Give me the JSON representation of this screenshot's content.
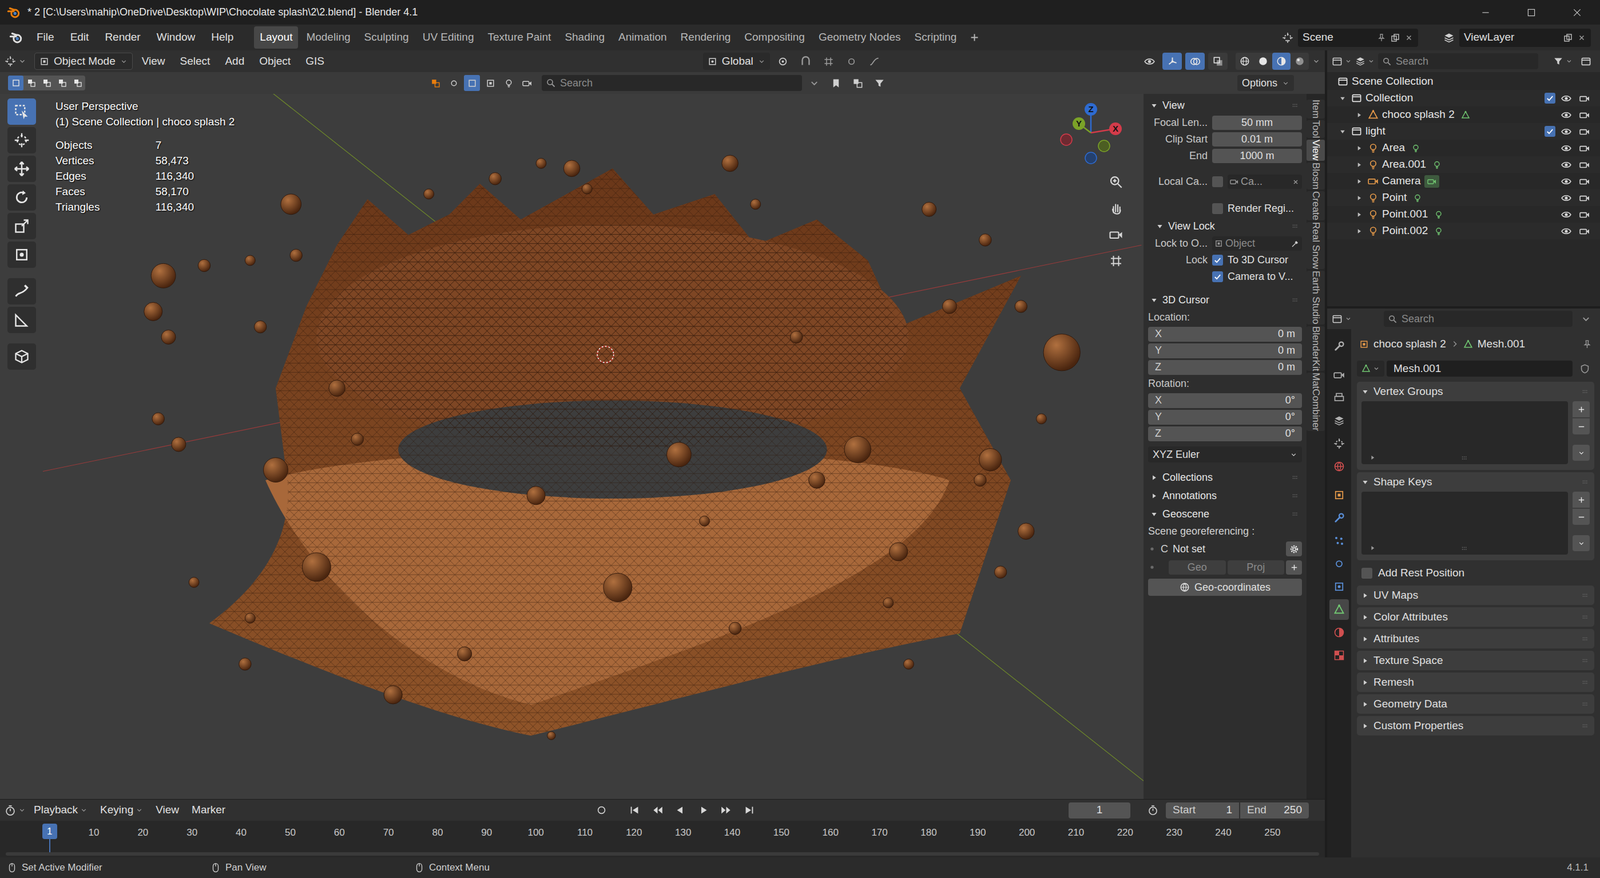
{
  "window": {
    "title": "* 2 [C:\\Users\\mahip\\OneDrive\\Desktop\\WIP\\Chocolate splash\\2\\2.blend] - Blender 4.1"
  },
  "menu": [
    "File",
    "Edit",
    "Render",
    "Window",
    "Help"
  ],
  "workspaces": [
    {
      "label": "Layout",
      "selected": true
    },
    {
      "label": "Modeling",
      "selected": false
    },
    {
      "label": "Sculpting",
      "selected": false
    },
    {
      "label": "UV Editing",
      "selected": false
    },
    {
      "label": "Texture Paint",
      "selected": false
    },
    {
      "label": "Shading",
      "selected": false
    },
    {
      "label": "Animation",
      "selected": false
    },
    {
      "label": "Rendering",
      "selected": false
    },
    {
      "label": "Compositing",
      "selected": false
    },
    {
      "label": "Geometry Nodes",
      "selected": false
    },
    {
      "label": "Scripting",
      "selected": false
    }
  ],
  "scene": "Scene",
  "view_layer": "ViewLayer",
  "viewport_header": {
    "mode": "Object Mode",
    "menus": [
      "View",
      "Select",
      "Add",
      "Object",
      "GIS"
    ],
    "orientation": "Global",
    "toggles": [
      {
        "kind": "gizmo",
        "on": true
      },
      {
        "kind": "overlay",
        "on": true
      },
      {
        "kind": "xray",
        "on": false
      }
    ],
    "shading": [
      {
        "kind": "wire",
        "selected": false
      },
      {
        "kind": "solid",
        "selected": false
      },
      {
        "kind": "mat",
        "selected": true
      },
      {
        "kind": "rendered",
        "selected": false
      }
    ]
  },
  "tool_header": {
    "select_modes": [
      {
        "kind": "set",
        "selected": true
      },
      {
        "kind": "extend",
        "selected": false
      },
      {
        "kind": "subtract",
        "selected": false
      },
      {
        "kind": "invert",
        "selected": false
      },
      {
        "kind": "intersect",
        "selected": false
      }
    ],
    "search_placeholder": "Search",
    "options": "Options"
  },
  "toolbar": [
    {
      "kind": "select",
      "selected": true
    },
    {
      "kind": "cursor3d",
      "selected": false
    },
    {
      "kind": "move",
      "selected": false
    },
    {
      "kind": "rotate",
      "selected": false
    },
    {
      "kind": "scale",
      "selected": false
    },
    {
      "kind": "transform",
      "selected": false
    },
    {
      "kind": "annotate",
      "selected": false
    },
    {
      "kind": "measure",
      "selected": false
    },
    {
      "kind": "addcube",
      "selected": false
    }
  ],
  "viewport": {
    "perspective": "User Perspective",
    "context": "(1) Scene Collection | choco splash 2",
    "stats": [
      {
        "label": "Objects",
        "value": "7"
      },
      {
        "label": "Vertices",
        "value": "58,473"
      },
      {
        "label": "Edges",
        "value": "116,340"
      },
      {
        "label": "Faces",
        "value": "58,170"
      },
      {
        "label": "Triangles",
        "value": "116,340"
      }
    ],
    "gizmo": {
      "x": "X",
      "y": "Y",
      "z": "Z"
    }
  },
  "n_panel": {
    "view": {
      "title": "View",
      "expanded": true,
      "fields": [
        {
          "label": "Focal Len...",
          "value": "50 mm"
        },
        {
          "label": "Clip Start",
          "value": "0.01 m"
        },
        {
          "label": "End",
          "value": "1000 m"
        }
      ],
      "local_camera": {
        "label": "Local Ca...",
        "checked": false,
        "value": "Ca..."
      },
      "render_region": {
        "label": "Render Regi...",
        "checked": false
      }
    },
    "view_lock": {
      "title": "View Lock",
      "expanded": true,
      "lock_to": {
        "label": "Lock to O...",
        "placeholder": "Object"
      },
      "lock_label": "Lock",
      "checks": [
        {
          "label": "To 3D Cursor",
          "checked": true
        },
        {
          "label": "Camera to V...",
          "checked": true
        }
      ]
    },
    "cursor": {
      "title": "3D Cursor",
      "expanded": true,
      "location_label": "Location:",
      "location": [
        {
          "axis": "X",
          "value": "0 m"
        },
        {
          "axis": "Y",
          "value": "0 m"
        },
        {
          "axis": "Z",
          "value": "0 m"
        }
      ],
      "rotation_label": "Rotation:",
      "rotation": [
        {
          "axis": "X",
          "value": "0°"
        },
        {
          "axis": "Y",
          "value": "0°"
        },
        {
          "axis": "Z",
          "value": "0°"
        }
      ],
      "rotation_mode": "XYZ Euler"
    },
    "collapsed": [
      {
        "title": "Collections",
        "expanded": false
      },
      {
        "title": "Annotations",
        "expanded": false
      }
    ],
    "geoscene": {
      "title": "Geoscene",
      "expanded": true,
      "label": "Scene georeferencing :",
      "crs_letter": "C",
      "crs_status": "Not set",
      "buttons": [
        {
          "label": "Geo",
          "disabled": true
        },
        {
          "label": "Proj",
          "disabled": true
        }
      ],
      "action": "Geo-coordinates"
    }
  },
  "side_tabs": [
    {
      "label": "Item",
      "selected": false
    },
    {
      "label": "Tool",
      "selected": false
    },
    {
      "label": "View",
      "selected": true
    },
    {
      "label": "Blosm",
      "selected": false
    },
    {
      "label": "Create",
      "selected": false
    },
    {
      "label": "Real Snow",
      "selected": false
    },
    {
      "label": "Earth Studio",
      "selected": false
    },
    {
      "label": "BlenderKit",
      "selected": false
    },
    {
      "label": "MatCombiner",
      "selected": false
    }
  ],
  "outliner": {
    "search_placeholder": "Search",
    "rows": [
      {
        "label": "Scene Collection",
        "depth": 0,
        "kind": "scene"
      },
      {
        "label": "Collection",
        "depth": 1,
        "kind": "collection",
        "expanded": true,
        "checked": true,
        "visible": true
      },
      {
        "label": "choco splash 2",
        "depth": 2,
        "kind": "mesh",
        "expanded": false,
        "visible": true
      },
      {
        "label": "light",
        "depth": 1,
        "kind": "collection",
        "expanded": true,
        "checked": true,
        "visible": true
      },
      {
        "label": "Area",
        "depth": 2,
        "kind": "light",
        "expanded": false,
        "visible": true
      },
      {
        "label": "Area.001",
        "depth": 2,
        "kind": "light",
        "expanded": false,
        "visible": true
      },
      {
        "label": "Camera",
        "depth": 2,
        "kind": "camera",
        "expanded": false,
        "visible": true
      },
      {
        "label": "Point",
        "depth": 2,
        "kind": "light",
        "expanded": false,
        "visible": true
      },
      {
        "label": "Point.001",
        "depth": 2,
        "kind": "light",
        "expanded": false,
        "visible": true
      },
      {
        "label": "Point.002",
        "depth": 2,
        "kind": "light",
        "expanded": false,
        "visible": true
      }
    ]
  },
  "properties": {
    "search_placeholder": "Search",
    "breadcrumb": [
      "choco splash 2",
      "Mesh.001"
    ],
    "datablock": "Mesh.001",
    "tabs": [
      {
        "kind": "tool",
        "selected": false
      },
      {
        "kind": "render",
        "selected": false
      },
      {
        "kind": "output",
        "selected": false
      },
      {
        "kind": "view_layer",
        "selected": false
      },
      {
        "kind": "scene",
        "selected": false
      },
      {
        "kind": "world",
        "selected": false
      },
      {
        "kind": "object",
        "selected": false
      },
      {
        "kind": "modifiers",
        "selected": false
      },
      {
        "kind": "particles",
        "selected": false
      },
      {
        "kind": "physics",
        "selected": false
      },
      {
        "kind": "constraints",
        "selected": false
      },
      {
        "kind": "data",
        "selected": true
      },
      {
        "kind": "material",
        "selected": false
      },
      {
        "kind": "texture",
        "selected": false
      }
    ],
    "panels": [
      {
        "title": "Vertex Groups",
        "kind": "list",
        "expanded": true
      },
      {
        "title": "Shape Keys",
        "kind": "list",
        "expanded": true
      },
      {
        "title": "Add Rest Position",
        "kind": "checkbox",
        "checked": false
      },
      {
        "title": "UV Maps",
        "kind": "panel",
        "expanded": false
      },
      {
        "title": "Color Attributes",
        "kind": "panel",
        "expanded": false
      },
      {
        "title": "Attributes",
        "kind": "panel",
        "expanded": false
      },
      {
        "title": "Texture Space",
        "kind": "panel",
        "expanded": false
      },
      {
        "title": "Remesh",
        "kind": "panel",
        "expanded": false
      },
      {
        "title": "Geometry Data",
        "kind": "panel",
        "expanded": false
      },
      {
        "title": "Custom Properties",
        "kind": "panel",
        "expanded": false
      }
    ]
  },
  "timeline": {
    "menus": [
      "Playback",
      "Keying",
      "View",
      "Marker"
    ],
    "current_frame": "1",
    "start_label": "Start",
    "start": "1",
    "end_label": "End",
    "end": "250",
    "playhead": "1",
    "ticks": [
      "10",
      "20",
      "30",
      "40",
      "50",
      "60",
      "70",
      "80",
      "90",
      "100",
      "110",
      "120",
      "130",
      "140",
      "150",
      "160",
      "170",
      "180",
      "190",
      "200",
      "210",
      "220",
      "230",
      "240",
      "250"
    ]
  },
  "status_bar": {
    "hints": [
      "Set Active Modifier",
      "Pan View",
      "Context Menu"
    ],
    "version": "4.1.1"
  }
}
